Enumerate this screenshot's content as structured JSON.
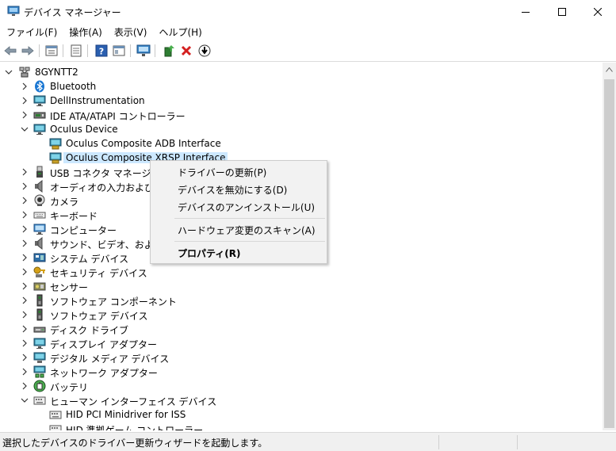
{
  "window": {
    "title": "デバイス マネージャー"
  },
  "menu": [
    "ファイル(F)",
    "操作(A)",
    "表示(V)",
    "ヘルプ(H)"
  ],
  "tree": {
    "root": "8GYNTT2",
    "items": [
      {
        "label": "Bluetooth",
        "icon": "bluetooth-icon",
        "expanded": false
      },
      {
        "label": "DellInstrumentation",
        "icon": "monitor-icon",
        "expanded": false
      },
      {
        "label": "IDE ATA/ATAPI コントローラー",
        "icon": "disk-controller-icon",
        "expanded": false
      },
      {
        "label": "Oculus Device",
        "icon": "monitor-icon",
        "expanded": true
      },
      {
        "label": "Oculus Composite ADB Interface",
        "icon": "device-icon",
        "child": true
      },
      {
        "label": "Oculus Composite XRSP Interface",
        "icon": "device-icon",
        "child": true,
        "selected": true
      },
      {
        "label": "USB コネクタ マネージャー",
        "icon": "usb-icon",
        "expanded": false
      },
      {
        "label": "オーディオの入力および出力",
        "icon": "speaker-icon",
        "expanded": false
      },
      {
        "label": "カメラ",
        "icon": "camera-icon",
        "expanded": false
      },
      {
        "label": "キーボード",
        "icon": "keyboard-icon",
        "expanded": false
      },
      {
        "label": "コンピューター",
        "icon": "computer-icon",
        "expanded": false
      },
      {
        "label": "サウンド、ビデオ、およびゲーム コントローラー",
        "icon": "speaker-icon",
        "expanded": false
      },
      {
        "label": "システム デバイス",
        "icon": "system-icon",
        "expanded": false
      },
      {
        "label": "セキュリティ デバイス",
        "icon": "key-icon",
        "expanded": false
      },
      {
        "label": "センサー",
        "icon": "sensor-icon",
        "expanded": false
      },
      {
        "label": "ソフトウェア コンポーネント",
        "icon": "component-icon",
        "expanded": false
      },
      {
        "label": "ソフトウェア デバイス",
        "icon": "component-icon",
        "expanded": false
      },
      {
        "label": "ディスク ドライブ",
        "icon": "drive-icon",
        "expanded": false
      },
      {
        "label": "ディスプレイ アダプター",
        "icon": "monitor-icon",
        "expanded": false
      },
      {
        "label": "デジタル メディア デバイス",
        "icon": "media-icon",
        "expanded": false
      },
      {
        "label": "ネットワーク アダプター",
        "icon": "network-icon",
        "expanded": false
      },
      {
        "label": "バッテリ",
        "icon": "battery-icon",
        "expanded": false
      },
      {
        "label": "ヒューマン インターフェイス デバイス",
        "icon": "hid-icon",
        "expanded": true
      },
      {
        "label": "HID PCI Minidriver for ISS",
        "icon": "hid-icon",
        "child": true
      },
      {
        "label": "HID 準拠ゲーム コントローラー",
        "icon": "hid-icon",
        "child": true
      }
    ]
  },
  "context_menu": {
    "items": [
      {
        "label": "ドライバーの更新(P)"
      },
      {
        "label": "デバイスを無効にする(D)"
      },
      {
        "label": "デバイスのアンインストール(U)"
      },
      {
        "label": "ハードウェア変更のスキャン(A)"
      },
      {
        "label": "プロパティ(R)",
        "bold": true
      }
    ]
  },
  "status": {
    "text": "選択したデバイスのドライバー更新ウィザードを起動します。"
  },
  "colors": {
    "selection": "#cce8ff",
    "context_bg": "#f2f2f2",
    "accent": "#0078d7"
  }
}
